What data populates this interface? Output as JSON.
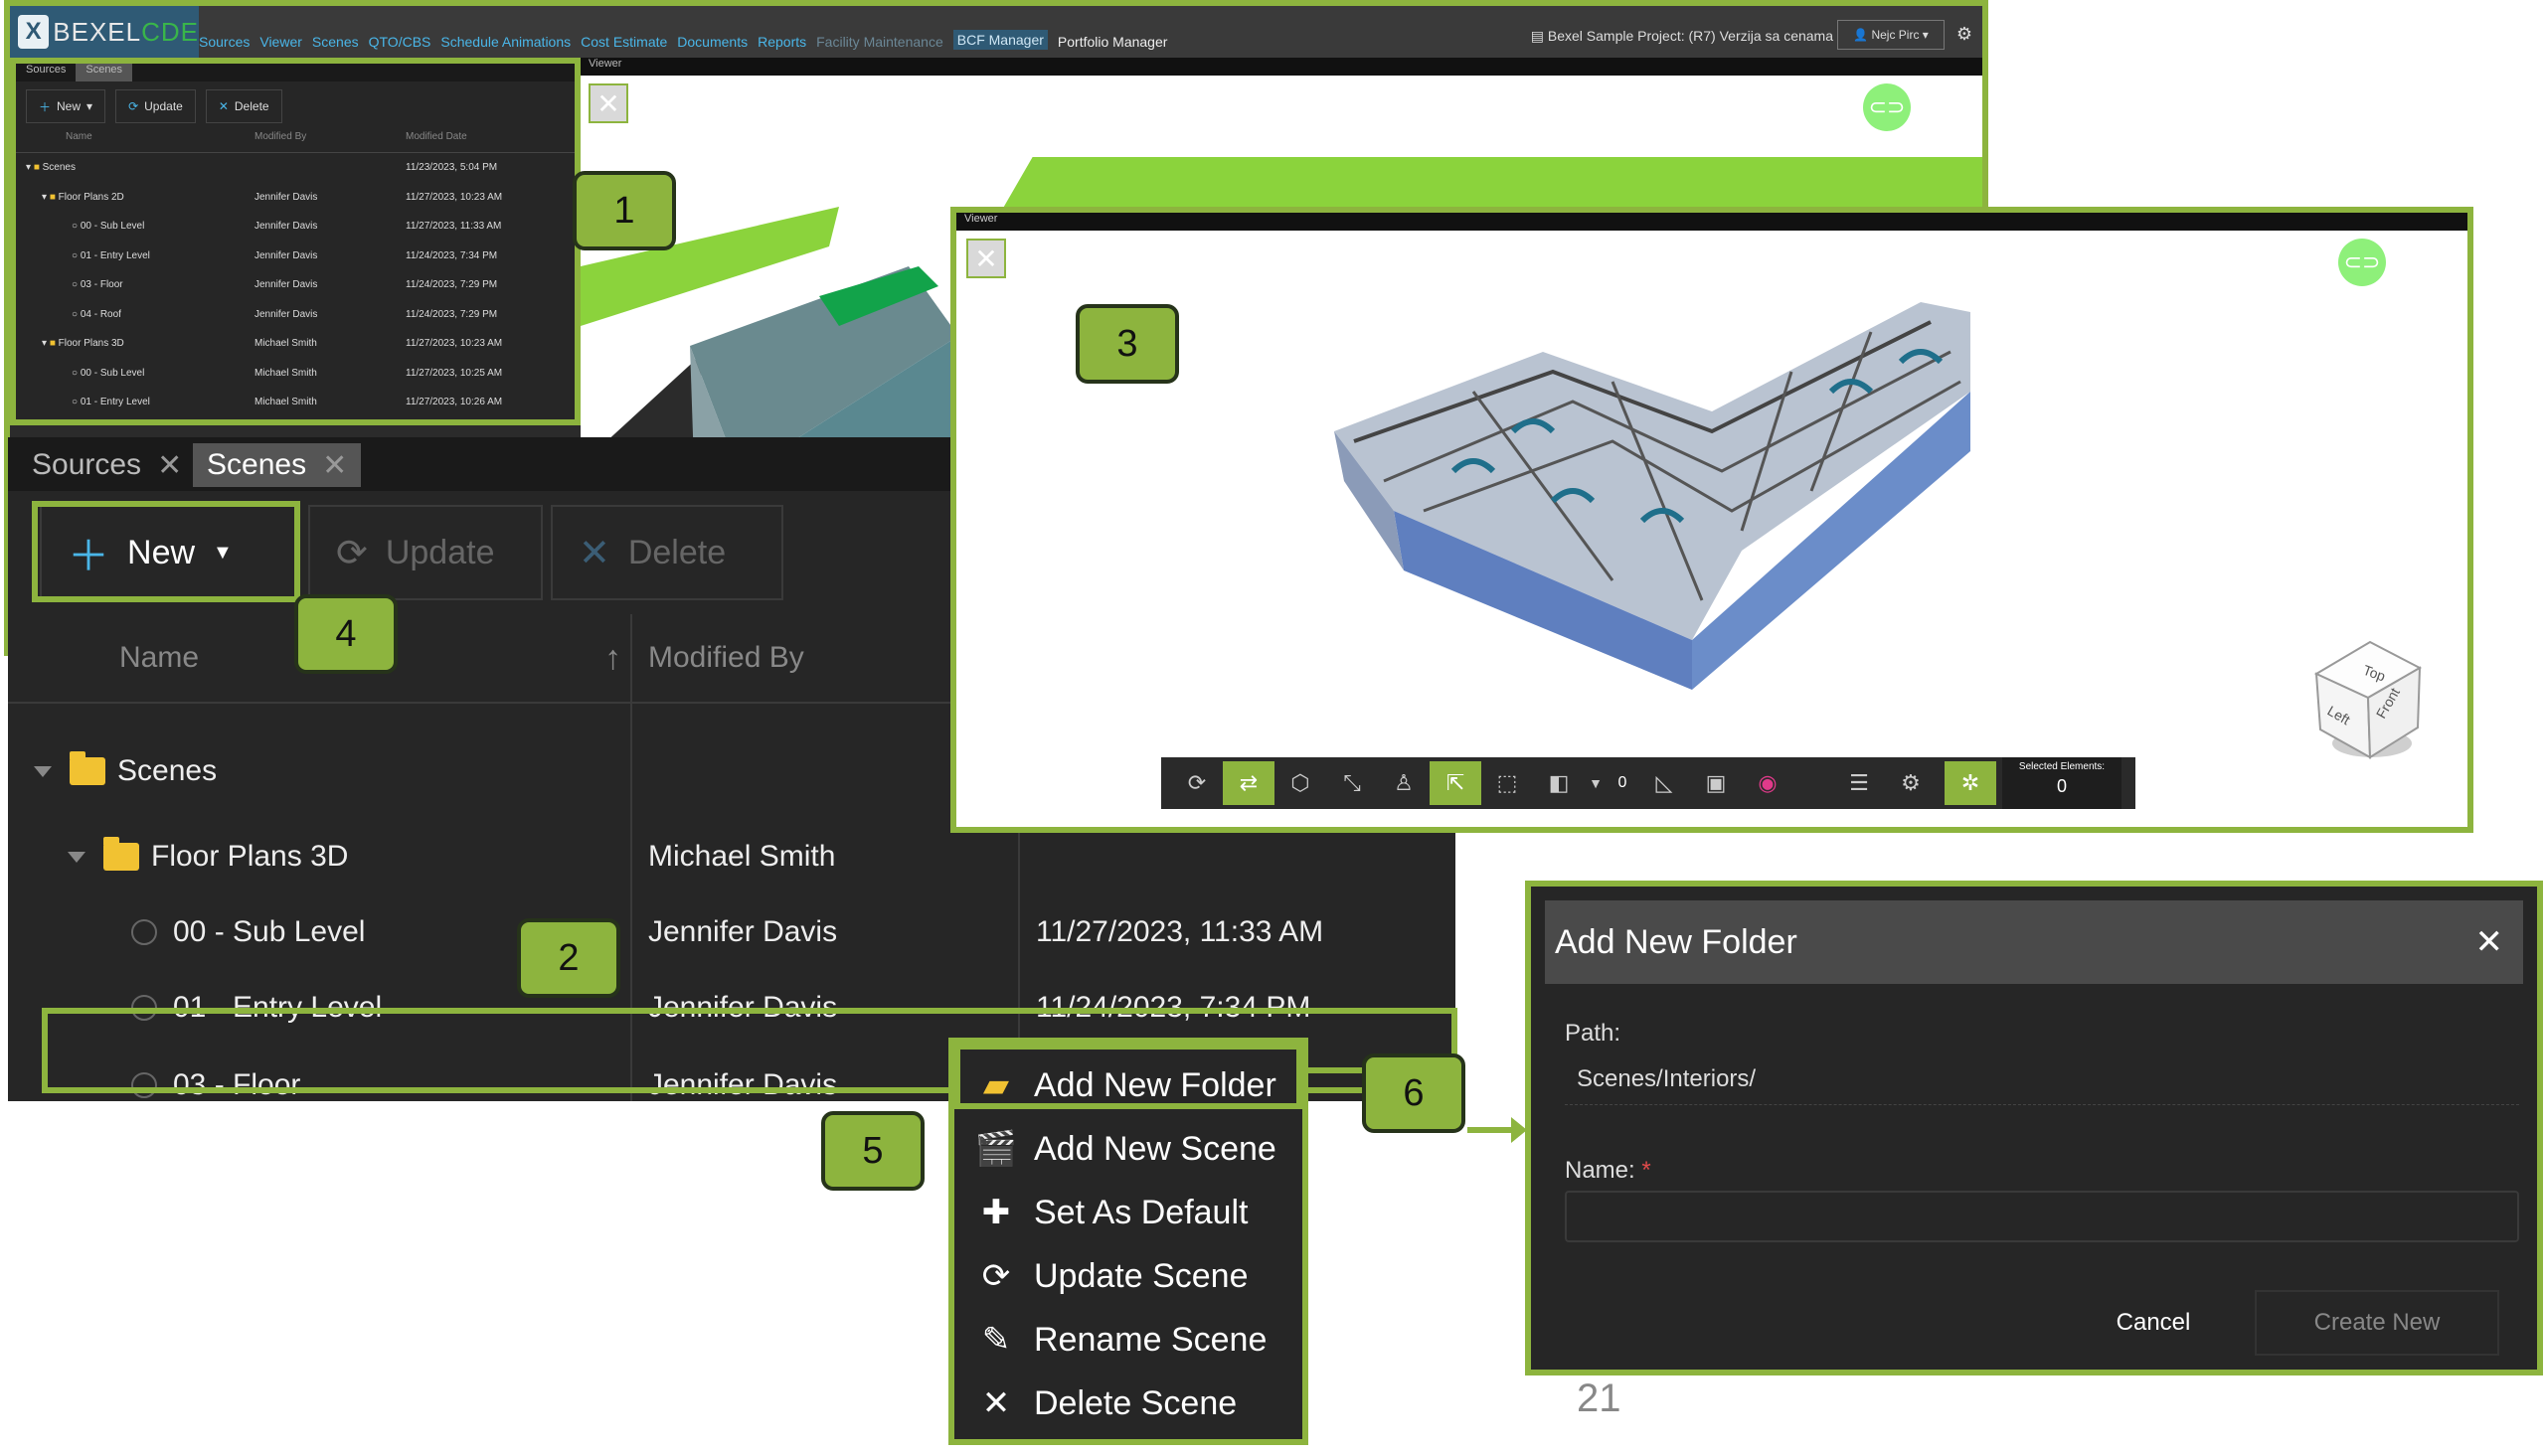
{
  "app": {
    "logo_mark": "X",
    "logo_text_a": "BEXEL",
    "logo_text_b": "CDE",
    "menu": [
      "Sources",
      "Viewer",
      "Scenes",
      "QTO/CBS",
      "Schedule Animations",
      "Cost Estimate",
      "Documents",
      "Reports",
      "Facility Maintenance",
      "BCF Manager",
      "Portfolio Manager"
    ],
    "project": "Bexel Sample Project: (R7) Verzija sa cenama",
    "user": "Nejc Pirc",
    "panel_tabs": [
      "Sources",
      "Scenes"
    ],
    "toolbar": [
      "New",
      "Update",
      "Delete"
    ],
    "columns": [
      "Name",
      "Modified By",
      "Modified Date"
    ],
    "rows": [
      {
        "name": "Scenes",
        "by": "",
        "date": "11/23/2023, 5:04 PM"
      },
      {
        "name": "Floor Plans 2D",
        "by": "Jennifer Davis",
        "date": "11/27/2023, 10:23 AM"
      },
      {
        "name": "00 - Sub Level",
        "by": "Jennifer Davis",
        "date": "11/27/2023, 11:33 AM"
      },
      {
        "name": "01 - Entry Level",
        "by": "Jennifer Davis",
        "date": "11/24/2023, 7:34 PM"
      },
      {
        "name": "03 - Floor",
        "by": "Jennifer Davis",
        "date": "11/24/2023, 7:29 PM"
      },
      {
        "name": "04 - Roof",
        "by": "Jennifer Davis",
        "date": "11/24/2023, 7:29 PM"
      },
      {
        "name": "Floor Plans 3D",
        "by": "Michael Smith",
        "date": "11/27/2023, 10:23 AM"
      },
      {
        "name": "00 - Sub Level",
        "by": "Michael Smith",
        "date": "11/27/2023, 10:25 AM"
      },
      {
        "name": "01 - Entry Level",
        "by": "Michael Smith",
        "date": "11/27/2023, 10:26 AM"
      }
    ],
    "viewer_tab": "Viewer"
  },
  "zoom": {
    "tabs": [
      "Sources",
      "Scenes"
    ],
    "buttons": {
      "new": "New",
      "update": "Update",
      "delete": "Delete"
    },
    "columns": {
      "name": "Name",
      "modified_by": "Modified By"
    },
    "rows": [
      {
        "name": "Scenes",
        "by": "",
        "date": ""
      },
      {
        "name": "Floor Plans 3D",
        "by": "Michael Smith",
        "date": ""
      },
      {
        "name": "00 - Sub Level",
        "by": "Jennifer Davis",
        "date": "11/27/2023, 11:33 AM"
      },
      {
        "name": "01 - Entry Level",
        "by": "Jennifer Davis",
        "date": "11/24/2023, 7:34 PM"
      },
      {
        "name": "03 - Floor",
        "by": "Jennifer Davis",
        "date": ""
      }
    ]
  },
  "viewer3": {
    "tab": "Viewer",
    "count": "0",
    "selected_label": "Selected Elements:",
    "selected_value": "0",
    "cube_top": "Top",
    "cube_left": "Left",
    "cube_front": "Front"
  },
  "context_menu": [
    "Add New Folder",
    "Add New Scene",
    "Set As Default",
    "Update Scene",
    "Rename Scene",
    "Delete Scene"
  ],
  "dialog": {
    "title": "Add New Folder",
    "path_label": "Path:",
    "path_value": "Scenes/Interiors/",
    "name_label": "Name:",
    "required_mark": "*",
    "cancel": "Cancel",
    "create": "Create New"
  },
  "callouts": [
    "1",
    "2",
    "3",
    "4",
    "5",
    "6"
  ],
  "page_number": "21",
  "colors": {
    "accent": "#8db43e",
    "link": "#4ab6e8",
    "panel": "#262626"
  }
}
